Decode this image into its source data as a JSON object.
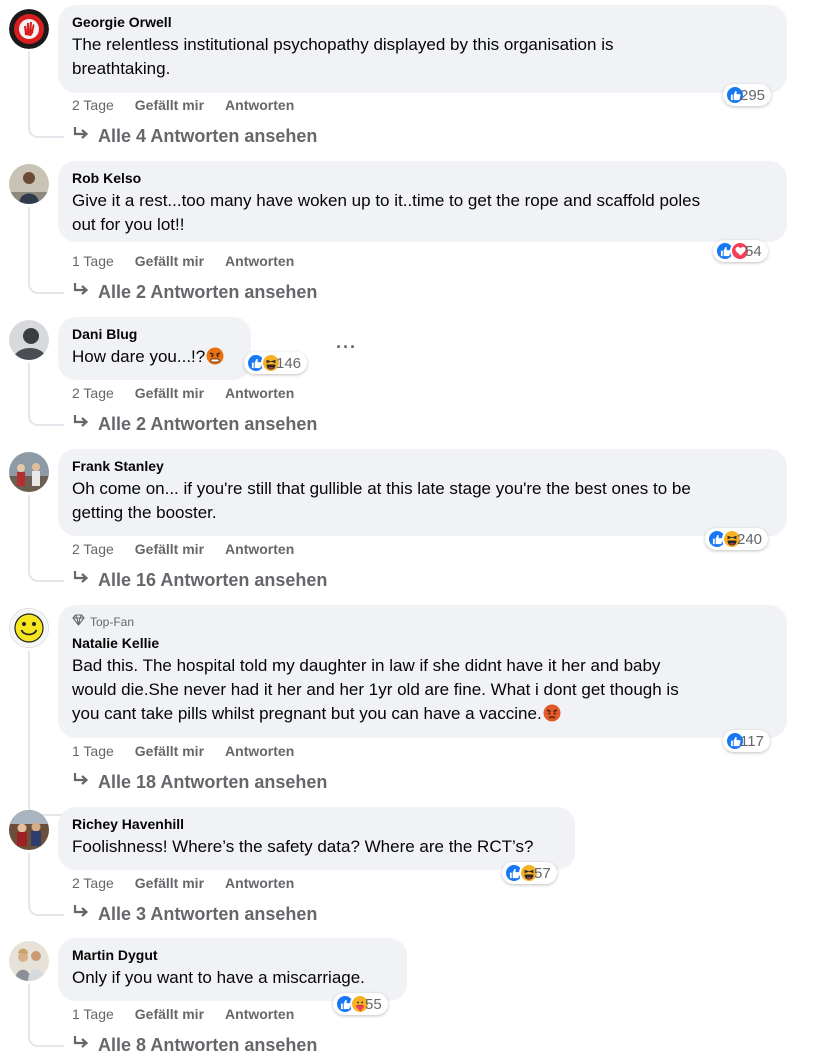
{
  "labels": {
    "like": "Gefällt mir",
    "reply": "Antworten"
  },
  "comments": [
    {
      "author": "Georgie Orwell",
      "lines": [
        "The relentless institutional psychopathy displayed by this organisation is",
        "breathtaking."
      ],
      "time": "2 Tage",
      "reactions": [
        "like-icon"
      ],
      "count": "295",
      "replies": "Alle 4 Antworten ansehen",
      "avatar": "stop-hand-avatar"
    },
    {
      "author": "Rob Kelso",
      "lines": [
        "Give it a rest...too many have woken up to it..time to get the rope and scaffold poles",
        "out for you lot!!"
      ],
      "time": "1 Tage",
      "reactions": [
        "like-icon",
        "love-icon"
      ],
      "count": "54",
      "replies": "Alle 2 Antworten ansehen",
      "avatar": "person-photo-avatar"
    },
    {
      "author": "Dani Blug",
      "lines": [
        "How dare you...!?"
      ],
      "emoji": "angry-emoji",
      "time": "2 Tage",
      "reactions": [
        "like-icon",
        "haha-icon"
      ],
      "count": "146",
      "replies": "Alle 2 Antworten ansehen",
      "avatar": "person-photo-avatar",
      "more": "···"
    },
    {
      "author": "Frank Stanley",
      "lines": [
        "Oh come on... if you're still that gullible at this late stage you're the best ones to be",
        "getting the booster."
      ],
      "time": "2 Tage",
      "reactions": [
        "like-icon",
        "haha-icon"
      ],
      "count": "240",
      "replies": "Alle 16 Antworten ansehen",
      "avatar": "group-photo-avatar"
    },
    {
      "author": "Natalie Kellie",
      "badge": "Top-Fan",
      "lines": [
        "Bad this. The hospital told my daughter in law if she didnt have it her and baby",
        "would die.She never had it her and her 1yr old are fine. What i dont get though is",
        "you cant take pills whilst pregnant but you can have a vaccine."
      ],
      "emoji": "angry-emoji",
      "time": "1 Tage",
      "reactions": [
        "like-icon"
      ],
      "count": "117",
      "replies": "Alle 18 Antworten ansehen",
      "avatar": "smiley-face-avatar"
    },
    {
      "author": "Richey Havenhill",
      "lines": [
        "Foolishness! Where’s the safety data? Where are the RCT’s?"
      ],
      "time": "2 Tage",
      "reactions": [
        "like-icon",
        "haha-icon"
      ],
      "count": "57",
      "replies": "Alle 3 Antworten ansehen",
      "avatar": "group-photo-avatar"
    },
    {
      "author": "Martin Dygut",
      "lines": [
        "Only if you want to have a miscarriage."
      ],
      "time": "1 Tage",
      "reactions": [
        "like-icon",
        "care-icon"
      ],
      "count": "55",
      "replies": "Alle 8 Antworten ansehen",
      "avatar": "couple-photo-avatar"
    }
  ]
}
